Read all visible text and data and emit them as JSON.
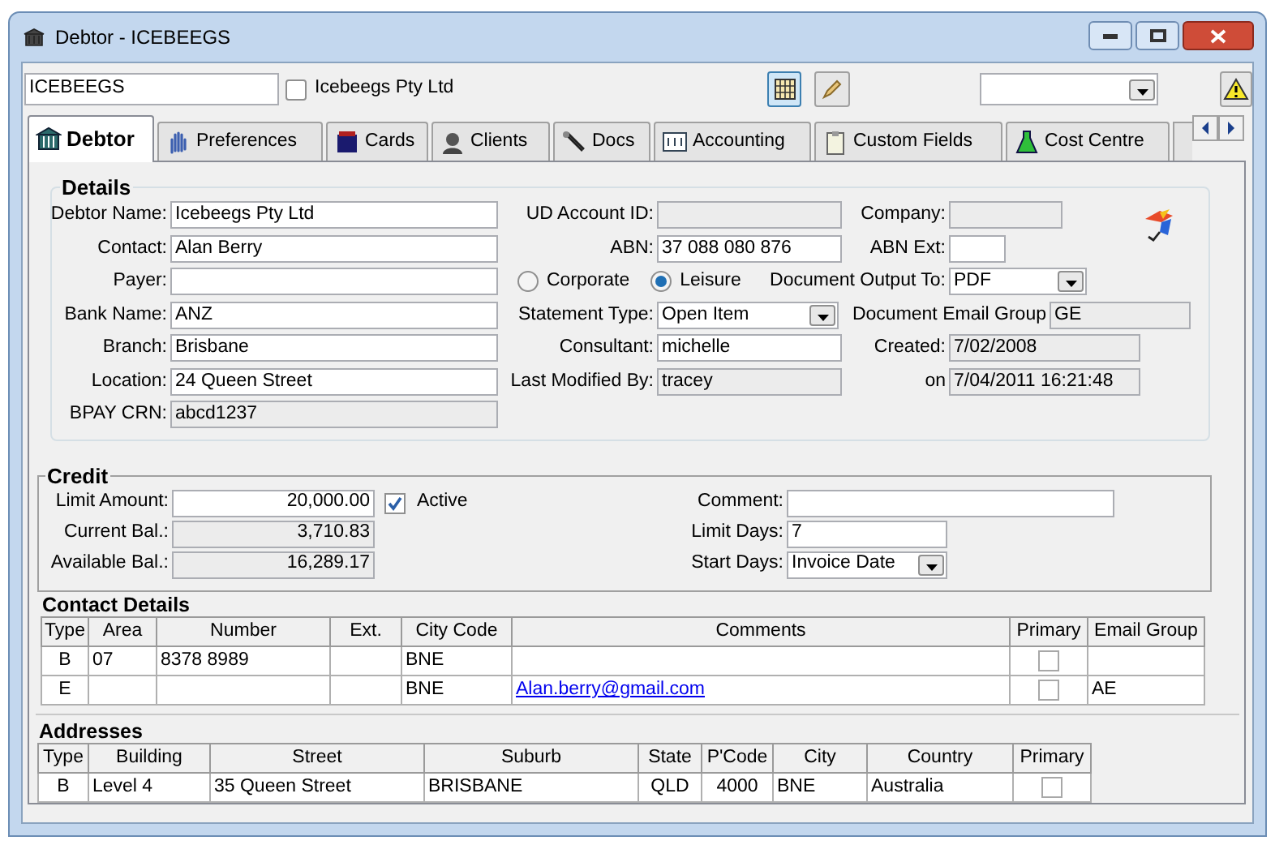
{
  "window": {
    "title": "Debtor - ICEBEEGS"
  },
  "header": {
    "code": "ICEBEEGS",
    "checkbox": {
      "label": "Icebeegs Pty Ltd",
      "checked": false
    }
  },
  "tabs": [
    {
      "label": "Debtor",
      "selected": true
    },
    {
      "label": "Preferences",
      "selected": false
    },
    {
      "label": "Cards",
      "selected": false
    },
    {
      "label": "Clients",
      "selected": false
    },
    {
      "label": "Docs",
      "selected": false
    },
    {
      "label": "Accounting",
      "selected": false
    },
    {
      "label": "Custom Fields",
      "selected": false
    },
    {
      "label": "Cost Centre",
      "selected": false
    }
  ],
  "details": {
    "title": "Details",
    "rows": [
      {
        "col1": {
          "kind": "field",
          "label": "Debtor Name:",
          "value": "Icebeegs Pty Ltd",
          "readonly": false
        },
        "col2": {
          "kind": "field",
          "label": "UD Account ID:",
          "readonly": true
        },
        "col3": {
          "kind": "field",
          "label": "Company:",
          "readonly": true
        }
      },
      {
        "col1": {
          "kind": "field",
          "label": "Contact:",
          "value": "Alan Berry",
          "readonly": false
        },
        "col2": {
          "kind": "field",
          "label": "ABN:",
          "value": "37 088 080 876",
          "readonly": false
        },
        "col3": {
          "kind": "field",
          "label": "ABN Ext:",
          "readonly": false
        }
      },
      {
        "col1": {
          "kind": "field",
          "label": "Payer:",
          "readonly": false
        },
        "col2": {
          "kind": "radio_group",
          "options": [
            {
              "label": "Corporate",
              "selected": false
            },
            {
              "label": "Leisure",
              "selected": true
            }
          ]
        },
        "col3": {
          "kind": "dropdown",
          "label": "Document Output To:",
          "value": "PDF"
        }
      },
      {
        "col1": {
          "kind": "field",
          "label": "Bank Name:",
          "value": "ANZ",
          "readonly": false
        },
        "col2": {
          "kind": "dropdown",
          "label": "Statement Type:",
          "value": "Open Item"
        },
        "col3": {
          "kind": "field",
          "label": "Document Email Group",
          "value": "GE",
          "readonly": true
        }
      },
      {
        "col1": {
          "kind": "field",
          "label": "Branch:",
          "value": "Brisbane",
          "readonly": false
        },
        "col2": {
          "kind": "field",
          "label": "Consultant:",
          "value": "michelle",
          "readonly": false
        },
        "col3": {
          "kind": "field",
          "label": "Created:",
          "value": "7/02/2008",
          "readonly": true
        }
      },
      {
        "col1": {
          "kind": "field",
          "label": "Location:",
          "value": "24 Queen Street",
          "readonly": false
        },
        "col2": {
          "kind": "field",
          "label": "Last Modified By:",
          "value": "tracey",
          "readonly": true
        },
        "col3": {
          "kind": "field",
          "label": "on",
          "value": "7/04/2011 16:21:48",
          "readonly": true
        }
      },
      {
        "col1": {
          "kind": "field",
          "label": "BPAY CRN:",
          "value": "abcd1237",
          "readonly": true
        }
      }
    ]
  },
  "credit": {
    "title": "Credit",
    "rows": [
      {
        "col1": {
          "kind": "field",
          "label": "Limit Amount:",
          "value": "20,000.00",
          "readonly": false
        },
        "checkbox": {
          "label": "Active",
          "checked": true
        },
        "col2": {
          "kind": "field",
          "label": "Comment:",
          "readonly": false
        }
      },
      {
        "col1": {
          "kind": "field",
          "label": "Current Bal.:",
          "value": "3,710.83",
          "readonly": true
        },
        "col2": {
          "kind": "field",
          "label": "Limit Days:",
          "value": "7",
          "readonly": false
        }
      },
      {
        "col1": {
          "kind": "field",
          "label": "Available Bal.:",
          "value": "16,289.17",
          "readonly": true
        },
        "col2": {
          "kind": "dropdown",
          "label": "Start Days:",
          "value": "Invoice Date"
        }
      }
    ]
  },
  "contacts": {
    "title": "Contact Details",
    "columns": [
      "Type",
      "Area",
      "Number",
      "Ext.",
      "City Code",
      "Comments",
      "Primary",
      "Email Group"
    ],
    "rows": [
      {
        "type": "B",
        "area": "07",
        "number": "8378 8989",
        "city_code": "BNE",
        "primary": false
      },
      {
        "type": "E",
        "city_code": "BNE",
        "comments": "Alan.berry@gmail.com",
        "comments_link": true,
        "primary": false,
        "email_group": "AE"
      }
    ]
  },
  "addresses": {
    "title": "Addresses",
    "columns": [
      "Type",
      "Building",
      "Street",
      "Suburb",
      "State",
      "P'Code",
      "City",
      "Country",
      "Primary"
    ],
    "rows": [
      {
        "type": "B",
        "building": "Level 4",
        "street": "35 Queen Street",
        "suburb": "BRISBANE",
        "state": "QLD",
        "pcode": "4000",
        "city": "BNE",
        "country": "Australia",
        "primary": false
      }
    ]
  }
}
